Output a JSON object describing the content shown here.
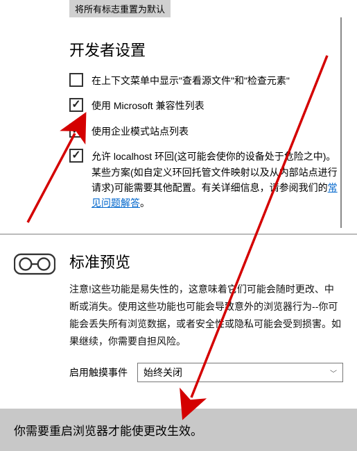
{
  "top_banner": "将所有标志重置为默认",
  "dev_settings": {
    "title": "开发者设置",
    "options": [
      {
        "label": "在上下文菜单中显示\"查看源文件\"和\"检查元素\"",
        "checked": false
      },
      {
        "label": "使用 Microsoft 兼容性列表",
        "checked": true
      },
      {
        "label": "使用企业模式站点列表",
        "checked": true
      }
    ],
    "localhost_prefix": "允许 localhost 环回(这可能会使你的设备处于危险之中)。某些方案(如自定义环回托管文件映射以及从内部站点进行请求)可能需要其他配置。有关详细信息，请参阅我们的",
    "localhost_link": "常见问题解答",
    "localhost_suffix": "。",
    "localhost_checked": true
  },
  "preview": {
    "title": "标准预览",
    "desc": "注意!这些功能是易失性的，这意味着它们可能会随时更改、中断或消失。使用这些功能也可能会导致意外的浏览器行为--你可能会丢失所有浏览数据，或者安全性或隐私可能会受到损害。如果继续，你需要自担风险。",
    "select_label": "启用触摸事件",
    "select_value": "始终关闭"
  },
  "restart_banner": "你需要重启浏览器才能使更改生效。"
}
